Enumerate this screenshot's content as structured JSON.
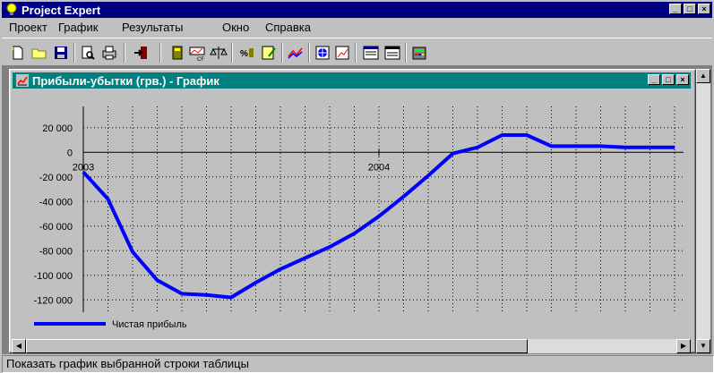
{
  "app": {
    "title": "Project Expert",
    "menu": [
      "Проект",
      "График",
      "Результаты",
      "Окно",
      "Справка"
    ]
  },
  "child": {
    "title": "Прибыли-убытки (грв.) - График"
  },
  "status": "Показать график выбранной строки таблицы",
  "chart_data": {
    "type": "line",
    "title": "",
    "ylim": [
      -130000,
      30000
    ],
    "yticks": [
      20000,
      0,
      -20000,
      -40000,
      -60000,
      -80000,
      -100000,
      -120000
    ],
    "ytick_labels": [
      "20 000",
      "0",
      "-20 000",
      "-40 000",
      "-60 000",
      "-80 000",
      "-100 000",
      "-120 000"
    ],
    "xtick_labels": [
      "2003",
      "2004"
    ],
    "grid": true,
    "legend_position": "bottom-left",
    "series": [
      {
        "name": "Чистая прибыль",
        "color": "#0000ff",
        "values": [
          -16000,
          -38000,
          -81000,
          -104000,
          -115000,
          -116000,
          -118000,
          -106000,
          -95000,
          -86000,
          -77000,
          -66000,
          -52000,
          -36000,
          -19000,
          -1000,
          4000,
          14000,
          14000,
          5000,
          5000,
          5000,
          4000,
          4000,
          4000
        ]
      }
    ]
  }
}
